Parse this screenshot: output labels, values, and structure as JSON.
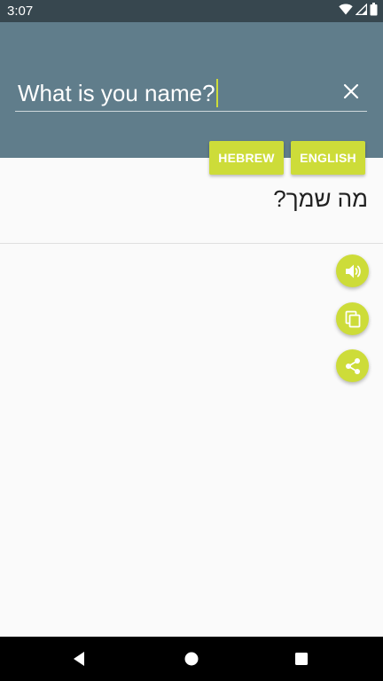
{
  "status_bar": {
    "time": "3:07",
    "icons": [
      "wifi-icon",
      "signal-icon",
      "battery-icon"
    ]
  },
  "input": {
    "value": "What is you name?"
  },
  "languages": {
    "source_label": "HEBREW",
    "target_label": "ENGLISH"
  },
  "translation": {
    "text": "מה שמך?"
  },
  "actions": [
    "speaker-icon",
    "copy-icon",
    "share-icon"
  ],
  "navigation": [
    "back-icon",
    "home-icon",
    "recents-icon"
  ],
  "colors": {
    "status_bar": "#37474f",
    "header": "#607d8b",
    "accent": "#cddc39",
    "background": "#fafafa"
  }
}
